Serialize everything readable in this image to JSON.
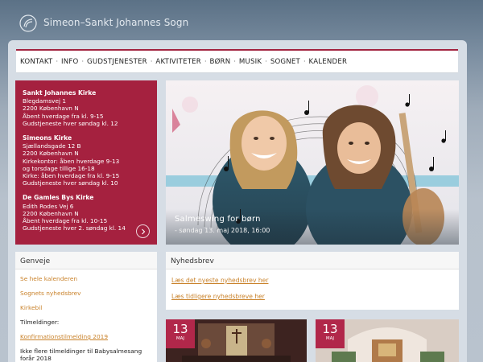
{
  "header": {
    "site_title": "Simeon–Sankt Johannes Sogn"
  },
  "nav": {
    "items": [
      "KONTAKT",
      "INFO",
      "GUDSTJENESTER",
      "AKTIVITETER",
      "BØRN",
      "MUSIK",
      "SOGNET",
      "KALENDER"
    ],
    "separator": "·"
  },
  "churches": [
    {
      "name": "Sankt Johannes Kirke",
      "lines": [
        "Blegdamsvej 1",
        "2200 København N",
        "Åbent hverdage fra kl. 9-15",
        "Gudstjeneste hver søndag kl. 12"
      ]
    },
    {
      "name": "Simeons Kirke",
      "lines": [
        "Sjællandsgade 12 B",
        "2200 København N",
        "Kirkekontor:  åben hverdage 9-13",
        "og torsdage tillige 16-18",
        "Kirke:  åben hverdage fra kl. 9-15",
        "Gudstjeneste hver søndag kl. 10"
      ]
    },
    {
      "name": "De Gamles Bys Kirke",
      "lines": [
        "Edith Rodes Vej 6",
        "2200 København N",
        "Åbent hverdage fra kl. 10-15",
        "Gudstjeneste hver 2. søndag kl. 14"
      ]
    }
  ],
  "hero": {
    "title": "Salmeswing for børn",
    "date": "- søndag 13. maj 2018, 16:00"
  },
  "genveje": {
    "heading": "Genveje",
    "see_calendar": "Se hele kalenderen",
    "parish_newsletter": "Sognets nyhedsbrev",
    "church_car": "Kirkebil",
    "registrations_label": "Tilmeldinger:",
    "confirmation_link": "Konfirmationstilmelding 2019",
    "no_more": "Ikke flere tilmeldinger til Babysalmesang forår 2018"
  },
  "nyhedsbrev": {
    "heading": "Nyhedsbrev",
    "latest_link": "Læs det nyeste nyhedsbrev her",
    "earlier_link": "Læs tidligere nyhedsbreve her"
  },
  "events": [
    {
      "day": "13",
      "month": "MAJ"
    },
    {
      "day": "13",
      "month": "MAJ"
    }
  ],
  "colors": {
    "accent": "#a5213f",
    "link": "#c9822a",
    "background": "#b7c1cc"
  }
}
